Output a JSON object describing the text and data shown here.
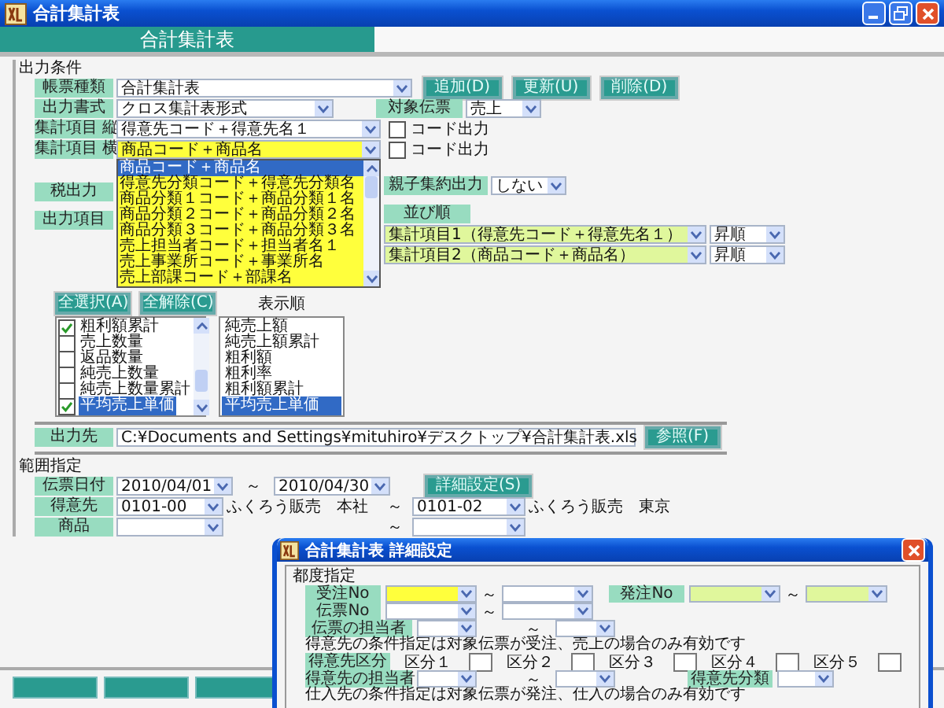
{
  "window": {
    "title": "合計集計表"
  },
  "header": {
    "title": "合計集計表"
  },
  "output_conditions": {
    "heading": "出力条件",
    "report_type": {
      "label": "帳票種類",
      "value": "合計集計表"
    },
    "buttons": [
      "追加(D)",
      "更新(U)",
      "削除(D)"
    ],
    "output_format": {
      "label": "出力書式",
      "value": "クロス集計表形式"
    },
    "target_slip": {
      "label": "対象伝票",
      "value": "売上"
    },
    "axis_rows": [
      {
        "label": "集計項目 縦",
        "value": "得意先コード＋得意先名１",
        "code_label": "コード出力",
        "checked": false,
        "focused": false,
        "open": false
      },
      {
        "label": "集計項目 横",
        "value": "商品コード＋商品名",
        "code_label": "コード出力",
        "checked": false,
        "focused": true,
        "open": true
      }
    ],
    "dropdown_options": [
      {
        "label": "商品コード＋商品名",
        "selected": true
      },
      {
        "label": "得意先分類コード＋得意先分類名",
        "selected": false
      },
      {
        "label": "商品分類１コード＋商品分類１名",
        "selected": false
      },
      {
        "label": "商品分類２コード＋商品分類２名",
        "selected": false
      },
      {
        "label": "商品分類３コード＋商品分類３名",
        "selected": false
      },
      {
        "label": "売上担当者コード＋担当者名１",
        "selected": false
      },
      {
        "label": "売上事業所コード＋事業所名",
        "selected": false
      },
      {
        "label": "売上部課コード＋部課名",
        "selected": false
      }
    ],
    "tax_output": {
      "label": "税出力"
    },
    "parent_child": {
      "label": "親子集約出力",
      "value": "しない"
    },
    "output_items": {
      "label": "出力項目",
      "select_all": "全選択(A)",
      "clear_all": "全解除(C)",
      "items": [
        {
          "label": "粗利額累計",
          "checked": true,
          "selected": false
        },
        {
          "label": "売上数量",
          "checked": false,
          "selected": false
        },
        {
          "label": "返品数量",
          "checked": false,
          "selected": false
        },
        {
          "label": "純売上数量",
          "checked": false,
          "selected": false
        },
        {
          "label": "純売上数量累計",
          "checked": false,
          "selected": false
        },
        {
          "label": "平均売上単価",
          "checked": true,
          "selected": true
        }
      ]
    },
    "display_order": {
      "heading": "表示順",
      "items": [
        {
          "label": "純売上額",
          "selected": false
        },
        {
          "label": "純売上額累計",
          "selected": false
        },
        {
          "label": "粗利額",
          "selected": false
        },
        {
          "label": "粗利率",
          "selected": false
        },
        {
          "label": "粗利額累計",
          "selected": false
        },
        {
          "label": "平均売上単価",
          "selected": true
        }
      ]
    },
    "sort_order": {
      "label": "並び順",
      "rows": [
        {
          "field": "集計項目1（得意先コード＋得意先名１）",
          "disabled": true,
          "direction": "昇順"
        },
        {
          "field": "集計項目2（商品コード＋商品名）",
          "disabled": true,
          "direction": "昇順"
        }
      ]
    },
    "destination": {
      "label": "出力先",
      "value": "C:¥Documents and Settings¥mituhiro¥デスクトップ¥合計集計表.xls",
      "browse": "参照(F)"
    }
  },
  "range": {
    "heading": "範囲指定",
    "details_button": "詳細設定(S)",
    "rows": [
      {
        "label": "伝票日付",
        "from": "2010/04/01",
        "separator": "～",
        "to": "2010/04/30"
      },
      {
        "label": "得意先",
        "from": "0101-00",
        "from_name": "ふくろう販売　本社",
        "separator": "～",
        "to": "0101-02",
        "to_name": "ふくろう販売　東京"
      },
      {
        "label": "商品",
        "separator": "～"
      }
    ]
  },
  "dialog": {
    "title": "合計集計表 詳細設定",
    "heading": "都度指定",
    "order_no": {
      "label": "受注No",
      "separator": "～",
      "focused": true
    },
    "purchase_no": {
      "label": "発注No",
      "separator": "～",
      "disabled": true
    },
    "slip_no": {
      "label": "伝票No",
      "separator": "～"
    },
    "slip_staff": {
      "label": "伝票の担当者",
      "separator": "～"
    },
    "customer_note": "得意先の条件指定は対象伝票が受注、売上の場合のみ有効です",
    "customer_class": {
      "label": "得意先区分",
      "classes": [
        "区分１",
        "区分２",
        "区分３",
        "区分４",
        "区分５"
      ]
    },
    "customer_staff": {
      "label": "得意先の担当者",
      "separator": "～"
    },
    "customer_category": {
      "label": "得意先分類"
    },
    "supplier_note": "仕入先の条件指定は対象伝票が発注、仕入の場合のみ有効です"
  }
}
